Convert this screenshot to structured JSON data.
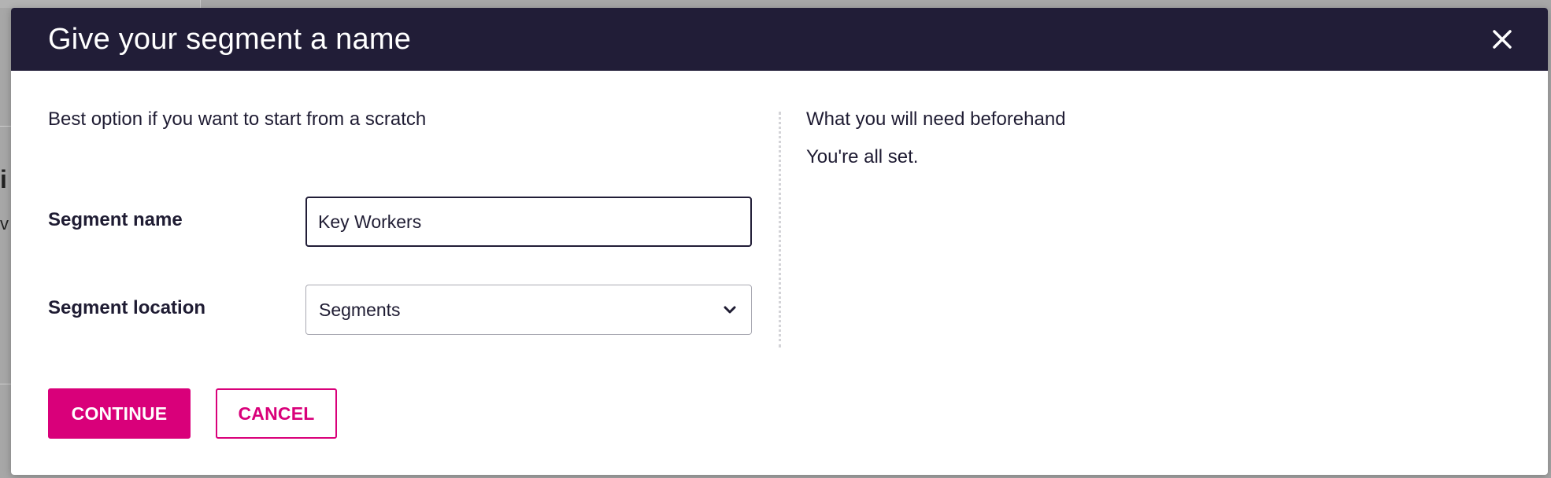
{
  "background": {
    "char_a": "i",
    "char_b": "v"
  },
  "modal": {
    "title": "Give your segment a name",
    "close_icon": "close-icon",
    "intro": "Best option if you want to start from a scratch",
    "fields": {
      "name_label": "Segment name",
      "name_value": "Key Workers",
      "location_label": "Segment location",
      "location_value": "Segments"
    },
    "requirements": {
      "title": "What you will need beforehand",
      "status": "You're all set."
    },
    "buttons": {
      "continue": "CONTINUE",
      "cancel": "CANCEL"
    }
  },
  "colors": {
    "header_bg": "#211d37",
    "accent": "#d9007a",
    "text": "#1f1c33"
  }
}
